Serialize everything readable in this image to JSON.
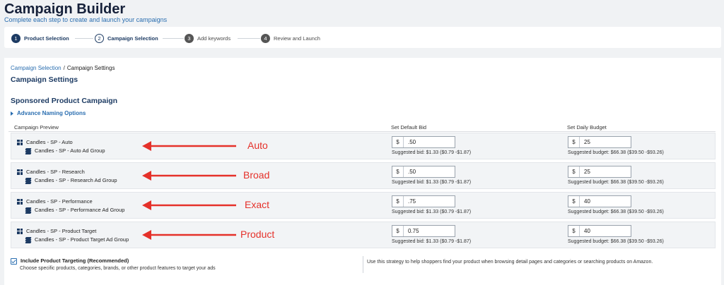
{
  "header": {
    "title": "Campaign Builder",
    "subtitle": "Complete each step to create and launch your campaigns"
  },
  "steps": [
    {
      "num": "1",
      "label": "Product Selection"
    },
    {
      "num": "2",
      "label": "Campaign Selection"
    },
    {
      "num": "3",
      "label": "Add keywords"
    },
    {
      "num": "4",
      "label": "Review and Launch"
    }
  ],
  "breadcrumb": {
    "parent": "Campaign Selection",
    "separator": "/",
    "current": "Campaign Settings"
  },
  "section_title": "Campaign Settings",
  "campaign_title": "Sponsored Product Campaign",
  "advanced_options": "Advance Naming Options",
  "columns": {
    "preview": "Campaign Preview",
    "bid": "Set Default Bid",
    "budget": "Set Daily Budget"
  },
  "currency_symbol": "$",
  "rows": [
    {
      "campaign": "Candles - SP - Auto",
      "ad_group": "Candles - SP - Auto Ad Group",
      "annotation": "Auto",
      "bid": ".50",
      "bid_hint": "Suggested bid: $1.33 ($0.79 -$1.87)",
      "budget": "25",
      "budget_hint": "Suggested budget: $66.38 ($39.50 -$93.26)"
    },
    {
      "campaign": "Candles - SP - Research",
      "ad_group": "Candles - SP - Research Ad Group",
      "annotation": "Broad",
      "bid": ".50",
      "bid_hint": "Suggested bid: $1.33 ($0.79 -$1.87)",
      "budget": "25",
      "budget_hint": "Suggested budget: $66.38 ($39.50 -$93.26)"
    },
    {
      "campaign": "Candles - SP - Performance",
      "ad_group": "Candles - SP - Performance Ad Group",
      "annotation": "Exact",
      "bid": ".75",
      "bid_hint": "Suggested bid: $1.33 ($0.79 -$1.87)",
      "budget": "40",
      "budget_hint": "Suggested budget: $66.38 ($39.50 -$93.26)"
    },
    {
      "campaign": "Candles - SP - Product Target",
      "ad_group": "Candles - SP - Product Target Ad Group",
      "annotation": "Product",
      "bid": "0.75",
      "bid_hint": "Suggested bid: $1.33 ($0.79 -$1.87)",
      "budget": "40",
      "budget_hint": "Suggested budget: $66.38 ($39.50 -$93.26)"
    }
  ],
  "product_targeting": {
    "label": "Include Product Targeting (Recommended)",
    "description": "Choose specific products, categories, brands, or other product features to target your ads",
    "checked": true,
    "strategy_note": "Use this strategy to help shoppers find your product when browsing detail pages and categories or searching products on Amazon."
  },
  "colors": {
    "accent": "#1d3b63",
    "link": "#2a6eb0",
    "annotation": "#e5312a"
  }
}
